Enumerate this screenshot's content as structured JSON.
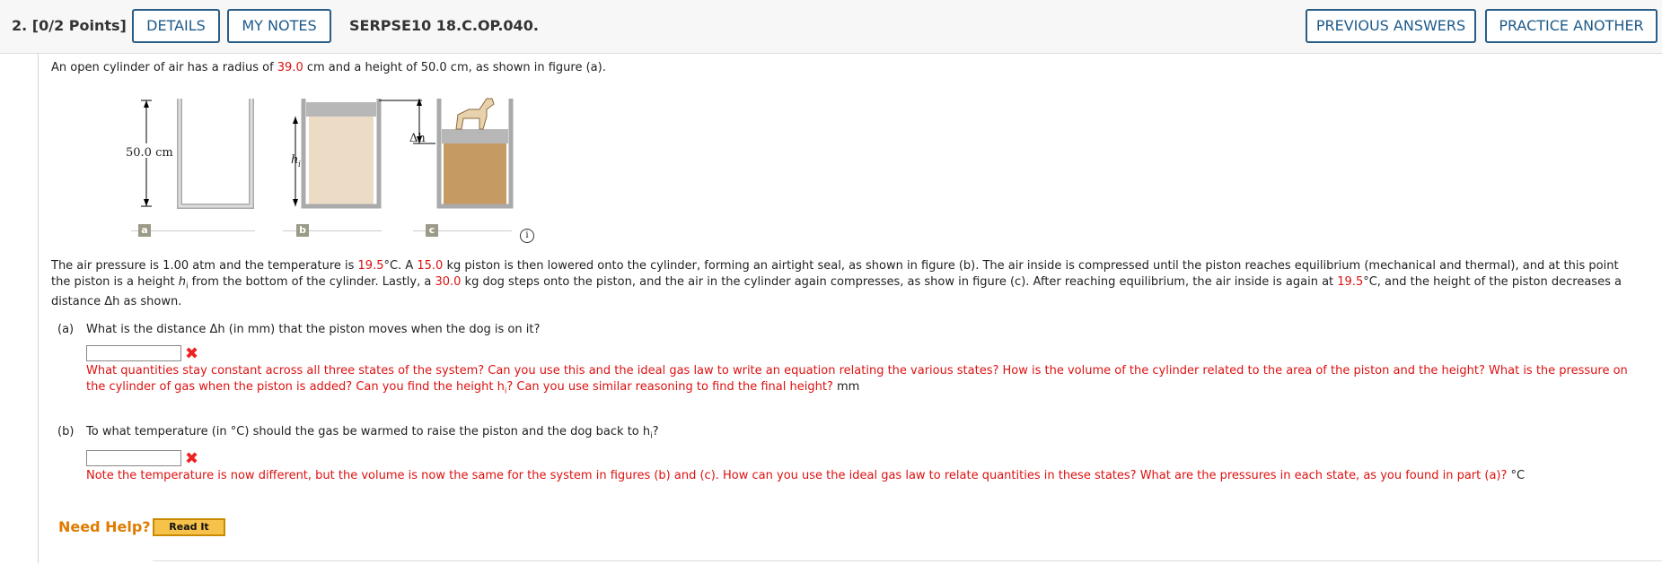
{
  "header": {
    "question_number": "2. [0/2 Points]",
    "details_label": "DETAILS",
    "notes_label": "MY NOTES",
    "question_id": "SERPSE10 18.C.OP.040.",
    "previous_answers_label": "PREVIOUS ANSWERS",
    "practice_another_label": "PRACTICE ANOTHER"
  },
  "problem": {
    "intro_a": "An open cylinder of air has a radius of ",
    "radius": "39.0",
    "intro_b": " cm and a height of 50.0 cm, as shown in figure (a).",
    "p1_a": "The air pressure is 1.00 atm and the temperature is ",
    "temp": "19.5",
    "p1_b": "°C. A ",
    "piston_mass": "15.0",
    "p1_c": " kg piston is then lowered onto the cylinder, forming an airtight seal, as shown in figure (b). The air inside is compressed until the piston reaches equilibrium (mechanical and thermal), and at this point",
    "p2_a": "the piston is a height ",
    "hi": "h",
    "hi_sub": "i",
    "p2_b": " from the bottom of the cylinder. Lastly, a ",
    "dog_mass": "30.0",
    "p2_c": " kg dog steps onto the piston, and the air in the cylinder again compresses, as show in figure (c). After reaching equilibrium, the air inside is again at ",
    "temp2": "19.5",
    "p2_d": "°C, and the height of the piston decreases a",
    "p3": "distance Δh as shown."
  },
  "figure": {
    "height_label": "50.0 cm",
    "hi_label": "h",
    "hi_sub": "i",
    "dh_label": "Δh",
    "tags": [
      "a",
      "b",
      "c"
    ],
    "info_icon": "info-icon"
  },
  "part_a": {
    "label": "(a)",
    "question": "What is the distance Δh (in mm) that the piston moves when the dog is on it?",
    "input_value": "",
    "feedback_line1": "What quantities stay constant across all three states of the system? Can you use this and the ideal gas law to write an equation relating the various states? How is the volume of the cylinder related to the area of the piston and the height? What is the pressure on",
    "feedback_line2": "the cylinder of gas when the piston is added? Can you find the height h",
    "feedback_sub": "i",
    "feedback_line2b": "? Can you use similar reasoning to find the final height?",
    "unit": "mm"
  },
  "part_b": {
    "label": "(b)",
    "question": "To what temperature (in °C) should the gas be warmed to raise the piston and the dog back to h",
    "question_sub": "i",
    "question_end": "?",
    "input_value": "",
    "feedback": "Note the temperature is now different, but the volume is now the same for the system in figures (b) and (c). How can you use the ideal gas law to relate quantities in these states? What are the pressures in each state, as you found in part (a)?",
    "unit": "°C"
  },
  "help": {
    "need_help": "Need Help?",
    "read_it": "Read It"
  },
  "colors": {
    "accent": "#1d5a8a",
    "error": "#dd1111",
    "help": "#e07b00"
  }
}
